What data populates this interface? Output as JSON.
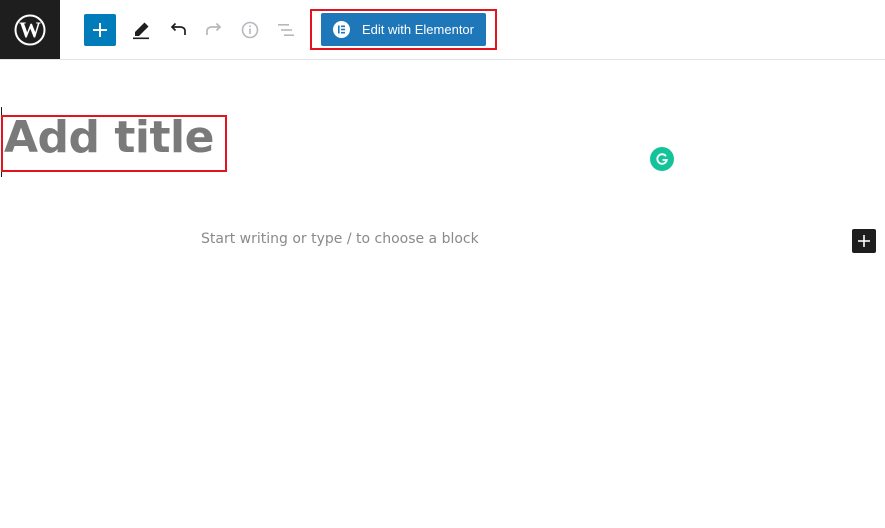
{
  "toolbar": {
    "logo_icon": "wordpress-icon",
    "add_block_icon": "plus-icon",
    "tools_icon": "pencil-icon",
    "undo_icon": "undo-icon",
    "redo_icon": "redo-icon",
    "info_icon": "info-icon",
    "outline_icon": "list-view-icon",
    "elementor_button": {
      "label": "Edit with Elementor",
      "icon": "elementor-icon",
      "color": "#1d77b9"
    },
    "accent_color": "#007cba"
  },
  "editor": {
    "title_placeholder": "Add title",
    "block_placeholder": "Start writing or type / to choose a block",
    "grammarly_icon": "grammarly-icon",
    "inline_add_icon": "plus-icon"
  },
  "annotations": {
    "highlight_color": "#e3141d"
  }
}
